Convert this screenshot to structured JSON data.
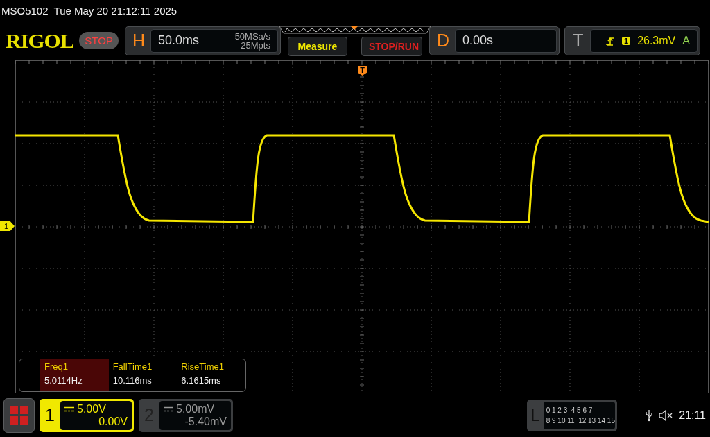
{
  "header": {
    "model": "MSO5102",
    "datetime": "Tue May 20 21:12:11 2025"
  },
  "toolbar": {
    "logo": "RIGOL",
    "run_state": "STOP",
    "horizontal": {
      "label": "H",
      "timebase": "50.0ms",
      "sample_rate": "50MSa/s",
      "memory_depth": "25Mpts"
    },
    "buttons": [
      {
        "label": "Measure",
        "kind": "measure"
      },
      {
        "label": "STOP/RUN",
        "kind": "stoprun"
      }
    ],
    "delay": {
      "label": "D",
      "value": "0.00s"
    },
    "trigger": {
      "label": "T",
      "source": "1",
      "level": "26.3mV",
      "mode": "A"
    }
  },
  "screen": {
    "channel_marker": "1",
    "trigger_marker": "T"
  },
  "measurements": [
    {
      "name": "Freq1",
      "value": "5.0114Hz",
      "selected": true
    },
    {
      "name": "FallTime1",
      "value": "10.116ms",
      "selected": false
    },
    {
      "name": "RiseTime1",
      "value": "6.1615ms",
      "selected": false
    }
  ],
  "channels": [
    {
      "number": "1",
      "scale": "5.00V",
      "offset": "0.00V",
      "active": true
    },
    {
      "number": "2",
      "scale": "5.00mV",
      "offset": "-5.40mV",
      "active": false
    }
  ],
  "logic": {
    "label": "L",
    "row_1": "0 1 2 3  4 5 6 7",
    "row_2": "8 9 10 11  12 13 14 15"
  },
  "status": {
    "time": "21:11"
  }
}
